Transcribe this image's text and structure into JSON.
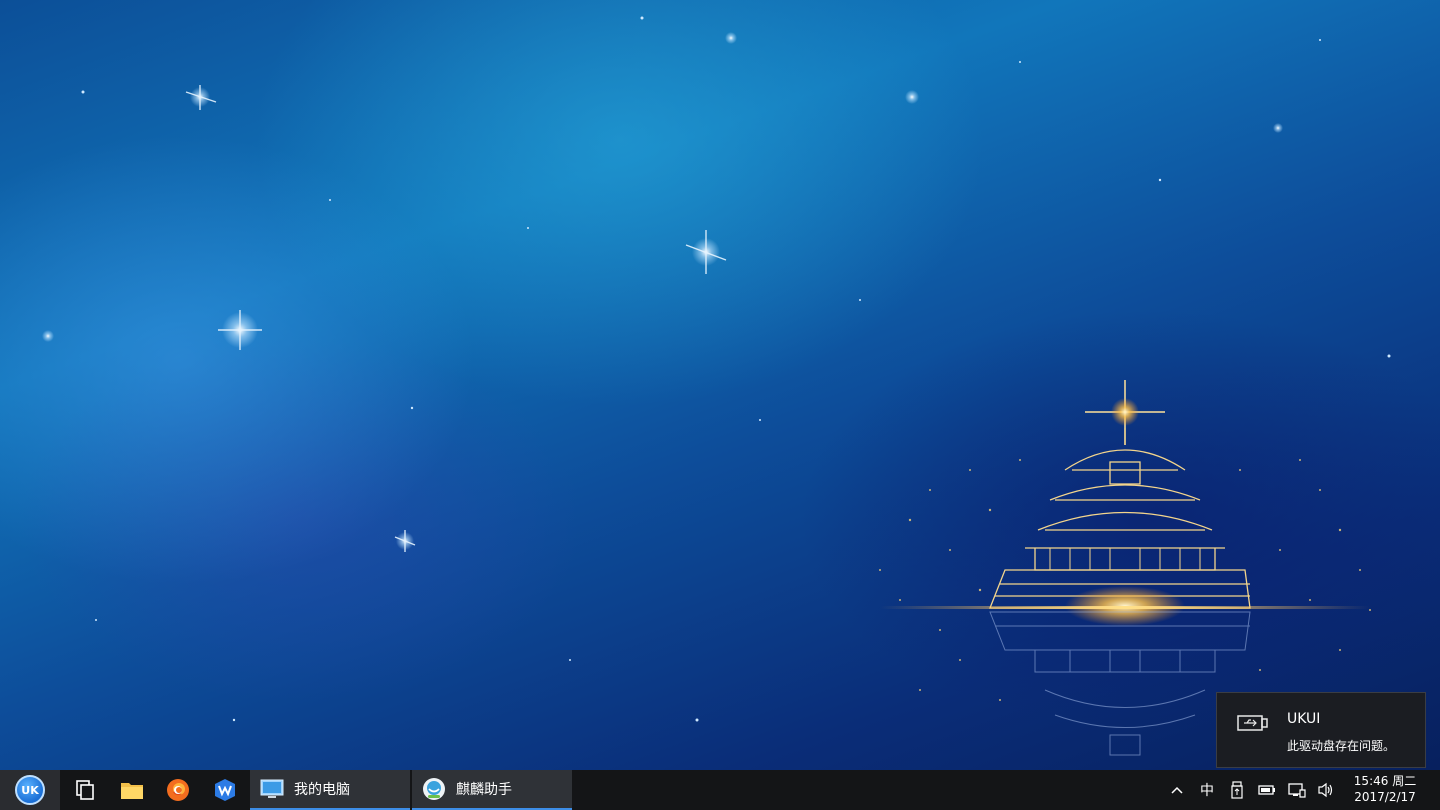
{
  "notification": {
    "title": "UKUI",
    "message": "此驱动盘存在问题。",
    "icon": "usb-drive-icon"
  },
  "taskbar": {
    "start_icon": "uk-logo-icon",
    "start_text": "UK",
    "quick_launch": [
      {
        "name": "show-desktop",
        "icon": "window-switch-icon"
      },
      {
        "name": "file-manager",
        "icon": "folder-icon"
      },
      {
        "name": "firefox",
        "icon": "firefox-icon"
      },
      {
        "name": "wps",
        "icon": "wps-icon"
      }
    ],
    "tasks": [
      {
        "label": "我的电脑",
        "icon": "computer-icon"
      },
      {
        "label": "麒麟助手",
        "icon": "assistant-icon"
      }
    ],
    "tray": {
      "expand_icon": "chevron-up-icon",
      "ime_label": "中",
      "items": [
        "usb-icon",
        "battery-icon",
        "network-icon",
        "volume-icon"
      ]
    },
    "clock": {
      "time": "15:46 周二",
      "date": "2017/2/17"
    }
  },
  "colors": {
    "taskbar_bg": "#141517",
    "active_task_bg": "#2f3237",
    "task_accent": "#3d8ee8",
    "notification_bg": "#1b1d22"
  }
}
